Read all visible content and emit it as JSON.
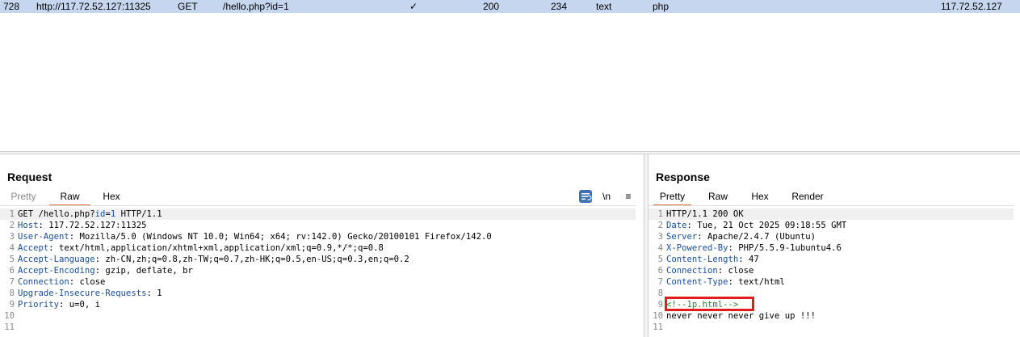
{
  "history_row": {
    "number": "728",
    "host": "http://117.72.52.127:11325",
    "method": "GET",
    "url": "/hello.php?id=1",
    "params": "✓",
    "status": "200",
    "length": "234",
    "mime": "text",
    "extension": "php",
    "ip": "117.72.52.127"
  },
  "request": {
    "title": "Request",
    "tabs": [
      "Pretty",
      "Raw",
      "Hex"
    ],
    "active_tab": "Raw",
    "tools": {
      "wrap_icon": "wrap-lines-icon",
      "newline": "\\n",
      "menu": "≡"
    },
    "lines": {
      "l1": {
        "a": "GET /hello.php?",
        "b": "id",
        "c": "=",
        "d": "1",
        "e": " HTTP/1.1"
      },
      "l2": {
        "key": "Host",
        "value": ": 117.72.52.127:11325"
      },
      "l3": {
        "key": "User-Agent",
        "value": ": Mozilla/5.0 (Windows NT 10.0; Win64; x64; rv:142.0) Gecko/20100101 Firefox/142.0"
      },
      "l4": {
        "key": "Accept",
        "value": ": text/html,application/xhtml+xml,application/xml;q=0.9,*/*;q=0.8"
      },
      "l5": {
        "key": "Accept-Language",
        "value": ": zh-CN,zh;q=0.8,zh-TW;q=0.7,zh-HK;q=0.5,en-US;q=0.3,en;q=0.2"
      },
      "l6": {
        "key": "Accept-Encoding",
        "value": ": gzip, deflate, br"
      },
      "l7": {
        "key": "Connection",
        "value": ": close"
      },
      "l8": {
        "key": "Upgrade-Insecure-Requests",
        "value": ": 1"
      },
      "l9": {
        "key": "Priority",
        "value": ": u=0, i"
      }
    },
    "line_numbers": [
      "1",
      "2",
      "3",
      "4",
      "5",
      "6",
      "7",
      "8",
      "9",
      "10",
      "11"
    ]
  },
  "response": {
    "title": "Response",
    "tabs": [
      "Pretty",
      "Raw",
      "Hex",
      "Render"
    ],
    "active_tab": "Pretty",
    "lines": {
      "l1": "HTTP/1.1 200 OK",
      "l2": {
        "key": "Date",
        "value": ": Tue, 21 Oct 2025 09:18:55 GMT"
      },
      "l3": {
        "key": "Server",
        "value": ": Apache/2.4.7 (Ubuntu)"
      },
      "l4": {
        "key": "X-Powered-By",
        "value": ": PHP/5.5.9-1ubuntu4.6"
      },
      "l5": {
        "key": "Content-Length",
        "value": ": 47"
      },
      "l6": {
        "key": "Connection",
        "value": ": close"
      },
      "l7": {
        "key": "Content-Type",
        "value": ": text/html"
      },
      "l9": "<!--1p.html-->",
      "l10": "never never never give up !!!"
    },
    "line_numbers": [
      "1",
      "2",
      "3",
      "4",
      "5",
      "6",
      "7",
      "8",
      "9",
      "10",
      "11"
    ],
    "highlight_color": "#e21b1b"
  }
}
